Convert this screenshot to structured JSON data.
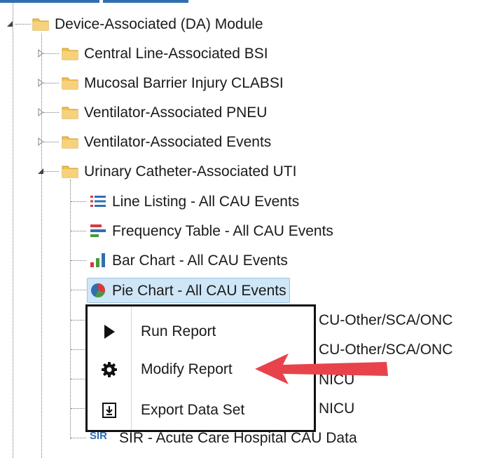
{
  "tree": {
    "module": {
      "label": "Device-Associated (DA) Module",
      "icon": "folder-icon"
    },
    "folders": [
      {
        "label": "Central Line-Associated BSI",
        "icon": "folder-icon",
        "expanded": false
      },
      {
        "label": "Mucosal Barrier Injury CLABSI",
        "icon": "folder-icon",
        "expanded": false
      },
      {
        "label": "Ventilator-Associated PNEU",
        "icon": "folder-icon",
        "expanded": false
      },
      {
        "label": "Ventilator-Associated Events",
        "icon": "folder-icon",
        "expanded": false
      },
      {
        "label": "Urinary Catheter-Associated UTI",
        "icon": "folder-icon",
        "expanded": true
      }
    ],
    "reports": [
      {
        "label": "Line Listing - All CAU Events",
        "icon": "line-listing-icon"
      },
      {
        "label": "Frequency Table - All CAU Events",
        "icon": "frequency-table-icon"
      },
      {
        "label": "Bar Chart - All CAU Events",
        "icon": "bar-chart-icon"
      },
      {
        "label": "Pie Chart - All CAU Events",
        "icon": "pie-chart-icon",
        "selected": true
      }
    ],
    "obscured_fragments": [
      "CU-Other/SCA/ONC",
      "CU-Other/SCA/ONC",
      "NICU",
      "NICU"
    ],
    "last_report": {
      "badge": "SIR",
      "label": "SIR - Acute Care Hospital CAU Data",
      "icon": "sir-icon"
    }
  },
  "context_menu": {
    "items": [
      {
        "label": "Run Report",
        "icon": "play-icon"
      },
      {
        "label": "Modify Report",
        "icon": "gear-icon"
      },
      {
        "label": "Export Data Set",
        "icon": "export-icon"
      }
    ]
  },
  "colors": {
    "selection_bg": "#cfe6f7",
    "annotation_arrow": "#e8434b",
    "folder": "#f2c14e"
  }
}
